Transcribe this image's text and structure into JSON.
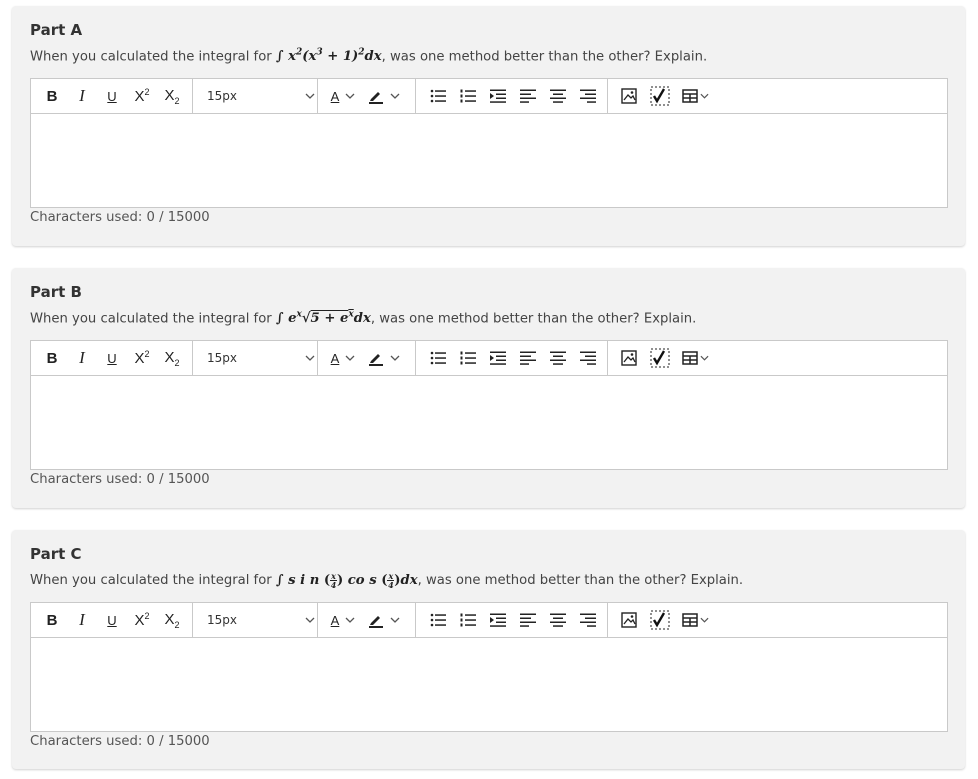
{
  "parts": [
    {
      "title": "Part A",
      "prompt_before": "When you calculated the integral for ",
      "integral_text": "∫ x²(x³ + 1)²dx",
      "prompt_after": ", was one method better than the other? Explain.",
      "font_size_value": "15px",
      "chars_used": "Characters used: 0 / 15000"
    },
    {
      "title": "Part B",
      "prompt_before": "When you calculated the integral for ",
      "integral_text": "∫ eˣ√(5 + eˣ)dx",
      "prompt_after": ", was one method better than the other? Explain.",
      "font_size_value": "15px",
      "chars_used": "Characters used: 0 / 15000"
    },
    {
      "title": "Part C",
      "prompt_before": "When you calculated the integral for ",
      "integral_text": "∫ sin(x/4) cos(x/4)dx",
      "prompt_after": ", was one method better than the other? Explain.",
      "font_size_value": "15px",
      "chars_used": "Characters used: 0 / 15000"
    }
  ],
  "toolbar": {
    "bold": "B",
    "italic": "I",
    "underline": "U",
    "superscript_base": "X",
    "superscript_mark": "2",
    "subscript_base": "X",
    "subscript_mark": "2",
    "text_color_letter": "A",
    "chevron": "⌄",
    "icons": [
      "bold-icon",
      "italic-icon",
      "underline-icon",
      "superscript-icon",
      "subscript-icon",
      "font-size-select",
      "text-color-icon",
      "highlight-icon",
      "bulleted-list-icon",
      "numbered-list-icon",
      "indent-icon",
      "align-left-icon",
      "align-center-icon",
      "align-right-icon",
      "image-icon",
      "math-icon",
      "table-icon"
    ]
  },
  "colors": {
    "card_bg": "#f2f2f2",
    "border": "#c9c9c9",
    "text": "#333333"
  }
}
